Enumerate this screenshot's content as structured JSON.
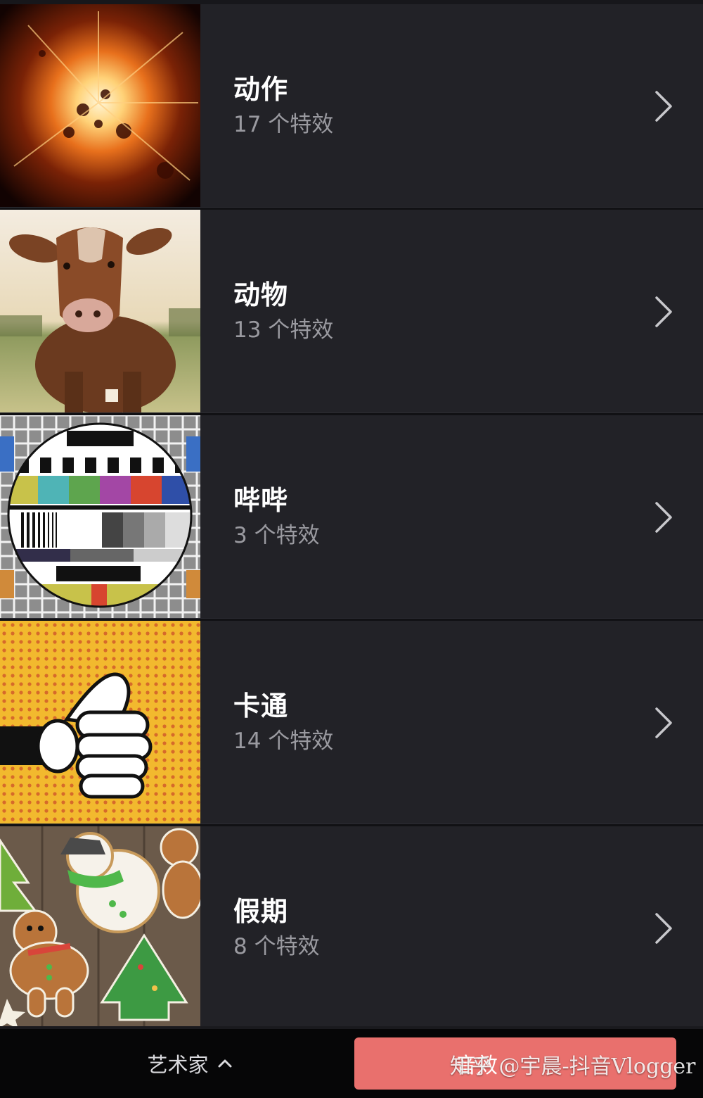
{
  "categories": [
    {
      "title": "动作",
      "count": "17 个特效",
      "thumb_icon": "explosion-image"
    },
    {
      "title": "动物",
      "count": "13 个特效",
      "thumb_icon": "cow-image"
    },
    {
      "title": "哔哔",
      "count": "3 个特效",
      "thumb_icon": "tv-test-pattern-image"
    },
    {
      "title": "卡通",
      "count": "14 个特效",
      "thumb_icon": "cartoon-thumbs-up-image"
    },
    {
      "title": "假期",
      "count": "8 个特效",
      "thumb_icon": "holiday-cookies-image"
    }
  ],
  "bottom_bar": {
    "category_label": "艺术家",
    "category_icon": "chevron-up-icon",
    "action_label": "音效"
  },
  "watermark": "知乎 @宇晨-抖音Vlogger",
  "colors": {
    "background": "#222227",
    "bottom_bar": "#060607",
    "accent": "#e9706d",
    "subtitle": "#9a9aa0"
  }
}
